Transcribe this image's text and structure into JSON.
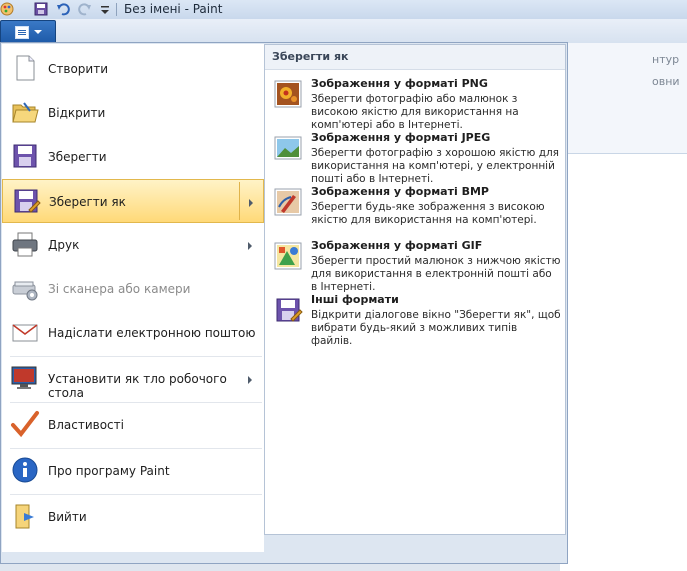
{
  "window": {
    "title": "Без імені - Paint"
  },
  "background": {
    "right_label_1": "нтур",
    "right_label_2": "овни"
  },
  "app_menu": {
    "items": [
      {
        "label": "Створити",
        "icon": "new-document-icon"
      },
      {
        "label": "Відкрити",
        "icon": "open-folder-icon"
      },
      {
        "label": "Зберегти",
        "icon": "save-icon"
      },
      {
        "label": "Зберегти як",
        "icon": "save-as-icon",
        "active": true
      },
      {
        "label": "Друк",
        "icon": "printer-icon"
      },
      {
        "label": "Зі сканера або камери",
        "icon": "scanner-icon",
        "disabled": true
      },
      {
        "label": "Надіслати електронною поштою",
        "icon": "email-icon"
      },
      {
        "label": "Установити як тло робочого стола",
        "icon": "desktop-background-icon"
      },
      {
        "label": "Властивості",
        "icon": "properties-check-icon"
      },
      {
        "label": "Про програму Paint",
        "icon": "info-icon"
      },
      {
        "label": "Вийти",
        "icon": "exit-icon"
      }
    ]
  },
  "save_as_pane": {
    "header": "Зберегти як",
    "formats": [
      {
        "title": "Зображення у форматі PNG",
        "description": "Зберегти фотографію або малюнок з високою якістю для використання на комп'ютері або в Інтернеті.",
        "icon": "png-image-icon"
      },
      {
        "title": "Зображення у форматі JPEG",
        "description": "Зберегти фотографію з хорошою якістю для використання на комп'ютері, у електронній пошті або в Інтернеті.",
        "icon": "jpeg-image-icon"
      },
      {
        "title": "Зображення у форматі BMP",
        "description": "Зберегти будь-яке зображення з високою якістю для використання на комп'ютері.",
        "icon": "bmp-image-icon"
      },
      {
        "title": "Зображення у форматі GIF",
        "description": "Зберегти простий малюнок з нижчою якістю для використання в електронній пошті або в Інтернеті.",
        "icon": "gif-image-icon"
      },
      {
        "title": "Інші формати",
        "description": "Відкрити діалогове вікно \"Зберегти як\", щоб вибрати будь-який з можливих типів файлів.",
        "icon": "other-formats-icon"
      }
    ]
  }
}
